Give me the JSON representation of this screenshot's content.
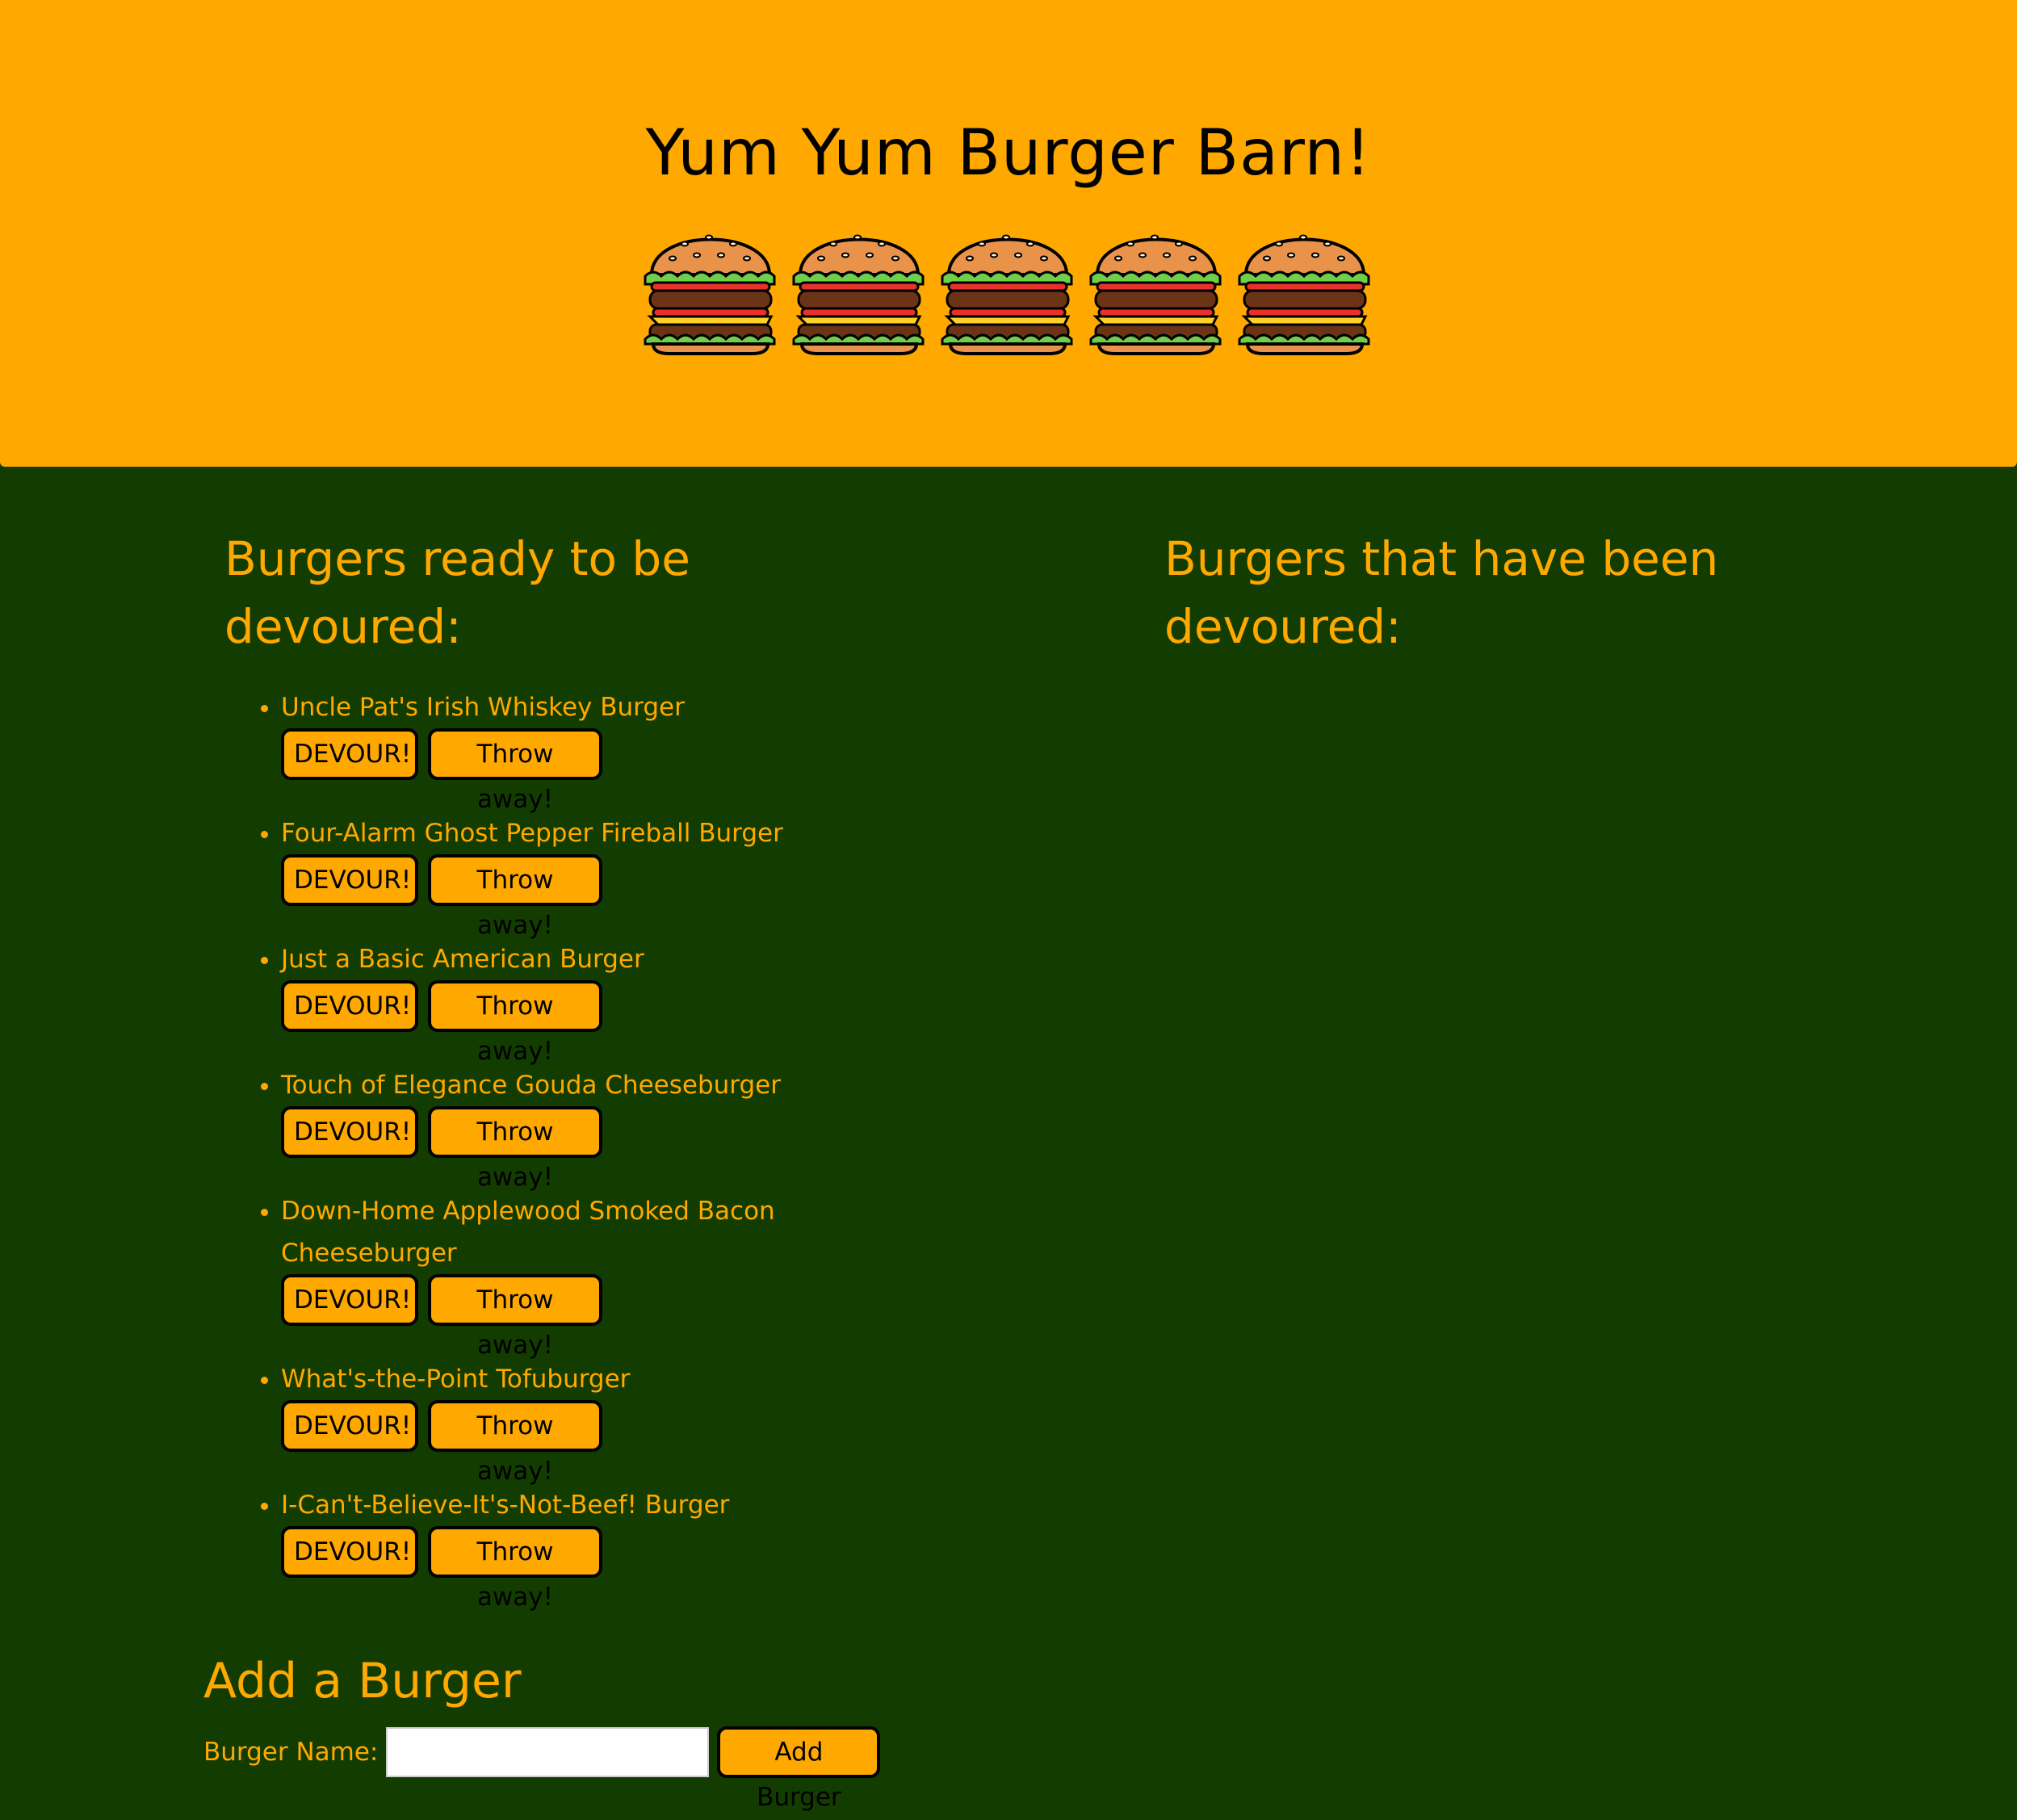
{
  "header": {
    "title": "Yum Yum Burger Barn!",
    "burger_icons": [
      "hamburger-icon",
      "hamburger-icon",
      "hamburger-icon",
      "hamburger-icon",
      "hamburger-icon"
    ]
  },
  "ready": {
    "title": "Burgers ready to be devoured:",
    "burgers": [
      {
        "name": "Uncle Pat's Irish Whiskey Burger",
        "devour_label": "DEVOUR!",
        "throw_label": "Throw away!"
      },
      {
        "name": "Four-Alarm Ghost Pepper Fireball Burger",
        "devour_label": "DEVOUR!",
        "throw_label": "Throw away!"
      },
      {
        "name": "Just a Basic American Burger",
        "devour_label": "DEVOUR!",
        "throw_label": "Throw away!"
      },
      {
        "name": "Touch of Elegance Gouda Cheeseburger",
        "devour_label": "DEVOUR!",
        "throw_label": "Throw away!"
      },
      {
        "name": "Down-Home Applewood Smoked Bacon Cheeseburger",
        "devour_label": "DEVOUR!",
        "throw_label": "Throw away!"
      },
      {
        "name": "What's-the-Point Tofuburger",
        "devour_label": "DEVOUR!",
        "throw_label": "Throw away!"
      },
      {
        "name": "I-Can't-Believe-It's-Not-Beef! Burger",
        "devour_label": "DEVOUR!",
        "throw_label": "Throw away!"
      }
    ]
  },
  "devoured": {
    "title": "Burgers that have been devoured:",
    "burgers": []
  },
  "add_form": {
    "title": "Add a Burger",
    "label": "Burger Name:",
    "input_value": "",
    "button_label": "Add Burger"
  },
  "colors": {
    "header_bg": "#ffa800",
    "page_bg": "#133d00",
    "accent": "#ffa800"
  }
}
